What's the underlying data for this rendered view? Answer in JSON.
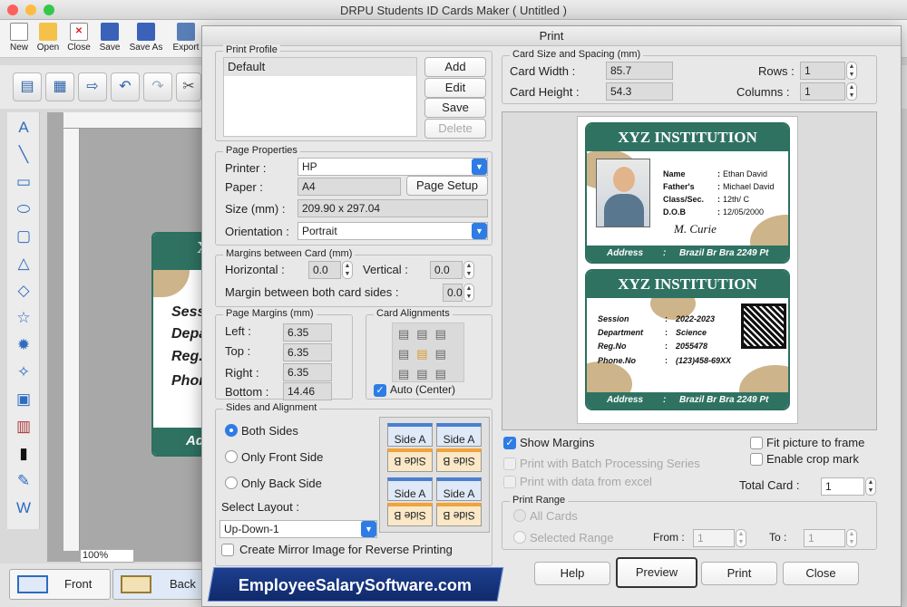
{
  "app": {
    "title": "DRPU Students ID Cards Maker ( Untitled )"
  },
  "menu_toolbar": [
    "New",
    "Open",
    "Close",
    "Save",
    "Save As",
    "Export"
  ],
  "zoom": "100%",
  "bottom_tabs": {
    "front": "Front",
    "back": "Back"
  },
  "background_card": {
    "lines": [
      "Sess",
      "Depa",
      "Reg.",
      "Phon"
    ],
    "top_letter": "X",
    "bottom_text": "Ad"
  },
  "dialog": {
    "title": "Print",
    "print_profile": {
      "label": "Print Profile",
      "items": [
        "Default"
      ],
      "add": "Add",
      "edit": "Edit",
      "save": "Save",
      "delete": "Delete"
    },
    "page_properties": {
      "label": "Page Properties",
      "printer_label": "Printer :",
      "printer_value": "HP",
      "paper_label": "Paper :",
      "paper_value": "A4",
      "page_setup": "Page Setup",
      "size_label": "Size (mm) :",
      "size_value": "209.90 x 297.04",
      "orientation_label": "Orientation :",
      "orientation_value": "Portrait"
    },
    "margins_between": {
      "label": "Margins between Card (mm)",
      "horizontal_label": "Horizontal :",
      "horizontal_value": "0.0",
      "vertical_label": "Vertical :",
      "vertical_value": "0.0",
      "both_label": "Margin between both card sides :",
      "both_value": "0.0"
    },
    "page_margins": {
      "label": "Page Margins (mm)",
      "left_label": "Left :",
      "left_value": "6.35",
      "top_label": "Top :",
      "top_value": "6.35",
      "right_label": "Right :",
      "right_value": "6.35",
      "bottom_label": "Bottom :",
      "bottom_value": "14.46"
    },
    "card_alignments": {
      "label": "Card Alignments",
      "auto_label": "Auto (Center)"
    },
    "sides": {
      "label": "Sides and Alignment",
      "both": "Both Sides",
      "front_only": "Only Front Side",
      "back_only": "Only Back Side",
      "select_layout": "Select Layout :",
      "layout_value": "Up-Down-1",
      "side_a": "Side A",
      "side_b": "Side B"
    },
    "mirror_label": "Create Mirror Image for Reverse Printing",
    "card_size": {
      "label": "Card Size and Spacing (mm)",
      "width_label": "Card Width :",
      "width_value": "85.7",
      "height_label": "Card Height :",
      "height_value": "54.3",
      "rows_label": "Rows :",
      "rows_value": "1",
      "columns_label": "Columns :",
      "columns_value": "1"
    },
    "preview": {
      "front": {
        "institution": "XYZ INSTITUTION",
        "fields": [
          [
            "Name",
            ":",
            "Ethan David"
          ],
          [
            "Father's",
            ":",
            "Michael David"
          ],
          [
            "Class/Sec.",
            ":",
            "12th/ C"
          ],
          [
            "D.O.B",
            ":",
            "12/05/2000"
          ]
        ],
        "address_label": "Address",
        ":": ":",
        "address_value": "Brazil Br Bra 2249 Pt",
        "signature": "M. Curie"
      },
      "back": {
        "institution": "XYZ INSTITUTION",
        "fields": [
          [
            "Session",
            ":",
            "2022-2023"
          ],
          [
            "Department",
            ":",
            "Science"
          ],
          [
            "Reg.No",
            ":",
            "2055478"
          ],
          [
            "Phone.No",
            ":",
            "(123)458-69XX"
          ]
        ],
        "address_label": "Address",
        "address_value": "Brazil Br Bra 2249 Pt"
      }
    },
    "options": {
      "show_margins": "Show Margins",
      "fit_picture": "Fit picture to frame",
      "crop_mark": "Enable crop mark",
      "batch": "Print with Batch Processing Series",
      "excel": "Print with data from excel",
      "total_card_label": "Total Card :",
      "total_card_value": "1"
    },
    "print_range": {
      "label": "Print Range",
      "all": "All Cards",
      "selected": "Selected Range",
      "from_label": "From :",
      "from_value": "1",
      "to_label": "To :",
      "to_value": "1"
    },
    "buttons": {
      "help": "Help",
      "preview": "Preview",
      "print": "Print",
      "close": "Close"
    }
  },
  "banner": "EmployeeSalarySoftware.com"
}
